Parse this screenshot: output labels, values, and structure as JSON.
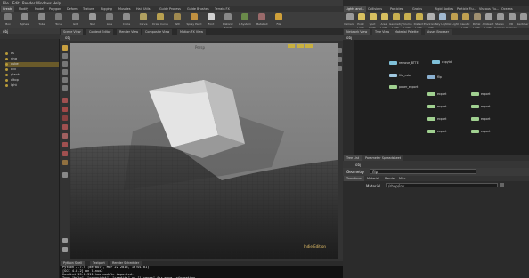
{
  "menubar": {
    "items": [
      "File",
      "Edit",
      "Render",
      "Windows",
      "Help"
    ],
    "right_status": "Auto Update",
    "right_label": "Main"
  },
  "shelf": {
    "tabs": [
      "Create",
      "Modify",
      "Model",
      "Polygon",
      "Deform",
      "Texture",
      "Rigging",
      "Muscles",
      "Hair Utils",
      "Guide Process",
      "Guide Brushes",
      "Terrain FX"
    ],
    "tools": [
      {
        "label": "Box",
        "icon": "box-icon",
        "color": "#7c7c7c"
      },
      {
        "label": "Sphere",
        "icon": "sphere-icon",
        "color": "#8c8c8c"
      },
      {
        "label": "Tube",
        "icon": "tube-icon",
        "color": "#8a8a8a"
      },
      {
        "label": "Torus",
        "icon": "torus-icon",
        "color": "#7a7a7a"
      },
      {
        "label": "Grid",
        "icon": "grid-icon",
        "color": "#888"
      },
      {
        "label": "Null",
        "icon": "null-icon",
        "color": "#9a9a9a"
      },
      {
        "label": "Line",
        "icon": "line-icon",
        "color": "#7e7e7e"
      },
      {
        "label": "Circle",
        "icon": "circle-icon",
        "color": "#8e8e8e"
      },
      {
        "label": "Curve",
        "icon": "curve-icon",
        "color": "#b0a060"
      },
      {
        "label": "Draw Curve",
        "icon": "draw-curve-icon",
        "color": "#b8a050"
      },
      {
        "label": "Path",
        "icon": "path-icon",
        "color": "#a08a50"
      },
      {
        "label": "Spray Paint",
        "icon": "spray-paint-icon",
        "color": "#c09040"
      },
      {
        "label": "Font",
        "icon": "font-icon",
        "color": "#d0d0d0"
      },
      {
        "label": "Platonic Solids",
        "icon": "platonic-icon",
        "color": "#888"
      },
      {
        "label": "L-System",
        "icon": "lsystem-icon",
        "color": "#6a8a4a"
      },
      {
        "label": "Metaball",
        "icon": "metaball-icon",
        "color": "#9a6a6a"
      },
      {
        "label": "File",
        "icon": "file-icon",
        "color": "#cfa03a"
      }
    ],
    "right_tabs": [
      "Lights and...",
      "Collisions",
      "Particles",
      "Grains",
      "Rigid Bodies",
      "Particle Flu...",
      "Viscous Flu...",
      "Oceans",
      "Fluid Conta...",
      "Populate Co...",
      "Container Tools",
      "Pyro FX",
      "Cloth",
      "Solid",
      "Wires",
      "Crowds",
      "Drive Simula..."
    ],
    "right_tools": [
      {
        "label": "Camera",
        "icon": "camera-icon",
        "color": "#9a9a9a"
      },
      {
        "label": "Point Light",
        "icon": "point-light-icon",
        "color": "#d8c060"
      },
      {
        "label": "Spot Light",
        "icon": "spot-light-icon",
        "color": "#d8c060"
      },
      {
        "label": "Area Light",
        "icon": "area-light-icon",
        "color": "#d8c060"
      },
      {
        "label": "Geometry Light",
        "icon": "geo-light-icon",
        "color": "#c8b050"
      },
      {
        "label": "Volume Light",
        "icon": "volume-light-icon",
        "color": "#c8b050"
      },
      {
        "label": "Distant Light",
        "icon": "distant-light-icon",
        "color": "#c8b050"
      },
      {
        "label": "Environment Light",
        "icon": "env-light-icon",
        "color": "#b0b0b0"
      },
      {
        "label": "Sky Light",
        "icon": "sky-light-icon",
        "color": "#a0b8d0"
      },
      {
        "label": "GI Light",
        "icon": "gi-light-icon",
        "color": "#c0a050"
      },
      {
        "label": "Caustic Light",
        "icon": "caustic-light-icon",
        "color": "#c0a050"
      },
      {
        "label": "Portal Light",
        "icon": "portal-light-icon",
        "color": "#a09070"
      },
      {
        "label": "Ambient Light",
        "icon": "ambient-light-icon",
        "color": "#a0a0a0"
      },
      {
        "label": "Stereo Camera",
        "icon": "stereo-camera-icon",
        "color": "#9a9a9a"
      },
      {
        "label": "VR Camera",
        "icon": "vr-camera-icon",
        "color": "#9a9a9a"
      },
      {
        "label": "Switcher",
        "icon": "switcher-icon",
        "color": "#9a9a9a"
      }
    ]
  },
  "left_tree": {
    "path": "obj",
    "items": [
      {
        "label": "cs",
        "selected": false
      },
      {
        "label": "ring",
        "selected": false
      },
      {
        "label": "cube",
        "selected": true
      },
      {
        "label": "ocll",
        "selected": false
      },
      {
        "label": "plank",
        "selected": false
      },
      {
        "label": "cltop",
        "selected": false
      },
      {
        "label": "lght",
        "selected": false
      }
    ]
  },
  "viewport": {
    "tabs": [
      "Scene View",
      "Context Editor",
      "Render View",
      "Composite View",
      "Motion FX View"
    ],
    "path": "obj",
    "camera_label": "Persp",
    "cam_menu": "No cam",
    "overlay_label": "Indie Edition",
    "top_right_badges": [
      "a",
      "b",
      "c"
    ]
  },
  "console": {
    "tabs": [
      "Python Shell",
      "Textport",
      "Render Scheduler"
    ],
    "lines": [
      "Python 2.7.5 (default, Mar 22 2016, 19:01:01)",
      "[GCC 4.8.2] on linux2",
      "Houdini 15.0.311 hou module imported.",
      "Type \"help\", \"copyright\", \"credits\" or \"license\" for more information."
    ]
  },
  "network": {
    "tabs": [
      "Network View",
      "Tree View",
      "Material Palette",
      "Asset Browser"
    ],
    "path": "obj",
    "nodes": [
      {
        "label": "remove_BTTE",
        "color": "#7fc0d8"
      },
      {
        "label": "copytdi",
        "color": "#7fc0d8"
      },
      {
        "label": "file_cube",
        "color": "#a0c8e0"
      },
      {
        "label": "paper_export",
        "color": "#a0d090"
      },
      {
        "label": "flip",
        "color": "#8ab0d0"
      },
      {
        "label": "export",
        "color": "#a0d090"
      },
      {
        "label": "export",
        "color": "#a0d090"
      },
      {
        "label": "export",
        "color": "#a0d090"
      },
      {
        "label": "export",
        "color": "#a0d090"
      },
      {
        "label": "export",
        "color": "#a0d090"
      },
      {
        "label": "export",
        "color": "#a0d090"
      },
      {
        "label": "export",
        "color": "#a0d090"
      },
      {
        "label": "export",
        "color": "#a0d090"
      }
    ]
  },
  "params": {
    "tabs": [
      "Tree List",
      "Parameter Spreadsheet"
    ],
    "path": "obj",
    "node_type": "Geometry",
    "node_name": "flip",
    "subtabs": [
      "Transform",
      "Material",
      "Render",
      "Misc"
    ],
    "material_label": "Material",
    "material_value": "/shop/ink"
  },
  "colors": {
    "accent": "#e8c36a",
    "selected": "#6a5a2a",
    "viewport_bg": "#8a8a8a"
  }
}
